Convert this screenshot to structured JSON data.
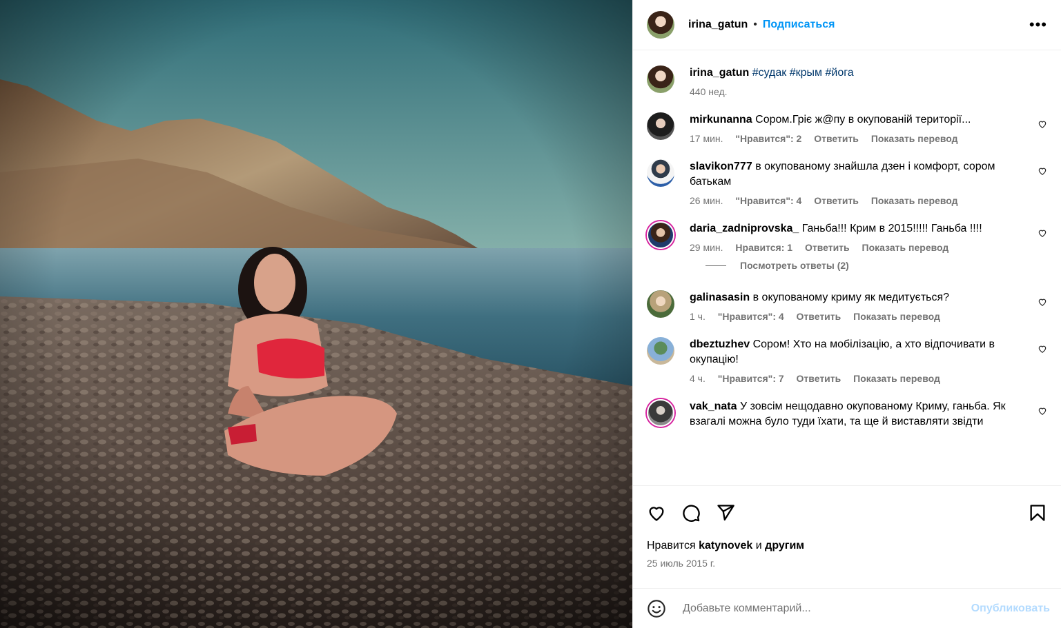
{
  "header": {
    "username": "irina_gatun",
    "dot": "•",
    "follow_label": "Подписаться",
    "more_label": "•••"
  },
  "caption": {
    "username": "irina_gatun",
    "hashtags": "#судак #крым #йога",
    "time": "440 нед."
  },
  "comments": [
    {
      "username": "mirkunanna",
      "text": "Сором.Гріє ж@пу в окупованій території...",
      "time": "17 мин.",
      "likes": "\"Нравится\": 2",
      "reply": "Ответить",
      "translate": "Показать перевод"
    },
    {
      "username": "slavikon777",
      "text": "в окупованому знайшла дзен і комфорт, сором батькам",
      "time": "26 мин.",
      "likes": "\"Нравится\": 4",
      "reply": "Ответить",
      "translate": "Показать перевод"
    },
    {
      "username": "daria_zadniprovska_",
      "text": "Ганьба!!! Крим в 2015!!!!! Ганьба !!!!",
      "time": "29 мин.",
      "likes": "Нравится: 1",
      "reply": "Ответить",
      "translate": "Показать перевод",
      "view_replies": "Посмотреть ответы (2)"
    },
    {
      "username": "galinasasin",
      "text": "в окупованому криму як медитується?",
      "time": "1 ч.",
      "likes": "\"Нравится\": 4",
      "reply": "Ответить",
      "translate": "Показать перевод"
    },
    {
      "username": "dbeztuzhev",
      "text": "Сором! Хто на мобілізацію, а хто відпочивати в окупацію!",
      "time": "4 ч.",
      "likes": "\"Нравится\": 7",
      "reply": "Ответить",
      "translate": "Показать перевод"
    },
    {
      "username": "vak_nata",
      "text": "У зовсім нещодавно окупованому Криму, ганьба. Як взагалі можна було туди їхати, та ще й виставляти звідти"
    }
  ],
  "likes_line": {
    "prefix": "Нравится",
    "user": "katynovek",
    "and": "и",
    "others": "другим"
  },
  "post_date": "25 июль 2015 г.",
  "composer": {
    "placeholder": "Добавьте комментарий...",
    "post_label": "Опубликовать"
  },
  "icons": {
    "like": "heart-icon",
    "comment": "comment-icon",
    "share": "share-icon",
    "save": "bookmark-icon",
    "emoji": "emoji-icon"
  }
}
